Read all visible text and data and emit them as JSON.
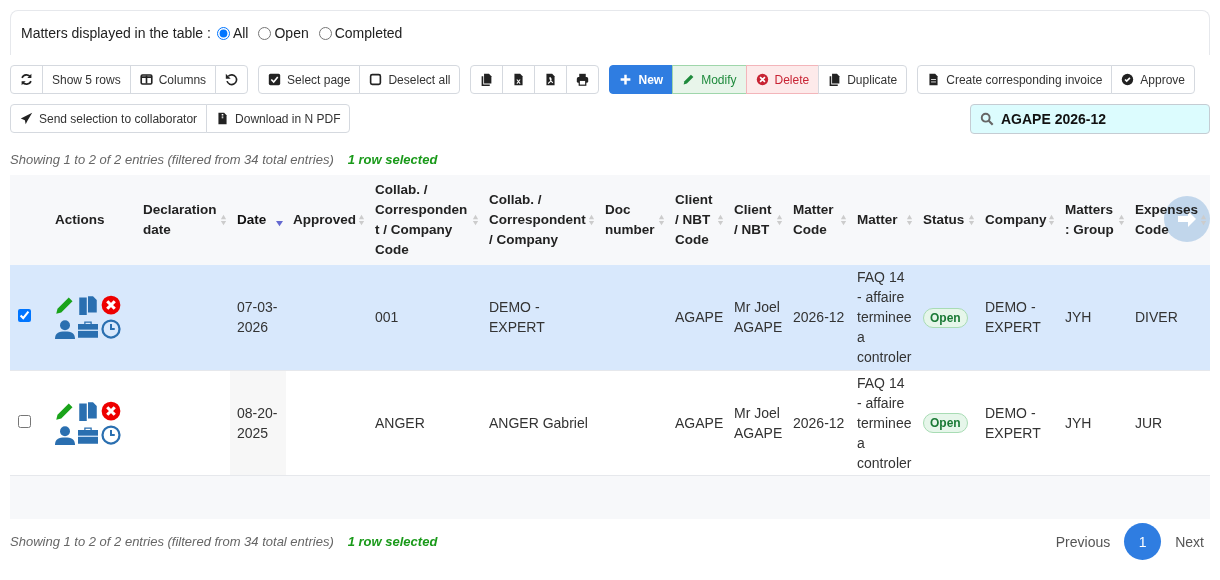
{
  "filter": {
    "label": "Matters displayed in the table :",
    "options": [
      {
        "label": "All",
        "selected": true
      },
      {
        "label": "Open",
        "selected": false
      },
      {
        "label": "Completed",
        "selected": false
      }
    ]
  },
  "toolbar": [
    [
      {
        "kind": "refresh"
      },
      {
        "kind": "text",
        "label": "Show 5 rows"
      },
      {
        "kind": "columns",
        "label": "Columns"
      },
      {
        "kind": "undo"
      }
    ],
    [
      {
        "kind": "check",
        "label": "Select page"
      },
      {
        "kind": "square",
        "label": "Deselect all"
      }
    ],
    [
      {
        "kind": "copy"
      },
      {
        "kind": "excel"
      },
      {
        "kind": "pdf"
      },
      {
        "kind": "print"
      }
    ],
    [
      {
        "kind": "plus",
        "label": "New"
      },
      {
        "kind": "pencil",
        "label": "Modify"
      },
      {
        "kind": "delete",
        "label": "Delete"
      },
      {
        "kind": "duplicate",
        "label": "Duplicate"
      }
    ],
    [
      {
        "kind": "file",
        "label": "Create corresponding invoice"
      },
      {
        "kind": "approve",
        "label": "Approve"
      }
    ],
    [
      {
        "kind": "send",
        "label": "Send selection to collaborator"
      },
      {
        "kind": "zip",
        "label": "Download in N PDF"
      }
    ]
  ],
  "search": {
    "value": "AGAPE 2026-12"
  },
  "info": "Showing 1 to 2 of 2 entries (filtered from 34 total entries)",
  "selection_info": "1 row selected",
  "table": {
    "columns": [
      {
        "label": "Actions",
        "sortable": false,
        "sorted_descending": false
      },
      {
        "label": "Declaration date",
        "sortable": true,
        "sorted_descending": false
      },
      {
        "label": "Date",
        "sortable": true,
        "sorted_descending": true
      },
      {
        "label": "Approved",
        "sortable": true,
        "sorted_descending": false
      },
      {
        "label": "Collab. / Correspondent / Company Code",
        "sortable": true,
        "sorted_descending": false
      },
      {
        "label": "Collab. / Correspondent / Company",
        "sortable": true,
        "sorted_descending": false
      },
      {
        "label": "Doc number",
        "sortable": true,
        "sorted_descending": false
      },
      {
        "label": "Client / NBT Code",
        "sortable": true,
        "sorted_descending": false
      },
      {
        "label": "Client / NBT",
        "sortable": true,
        "sorted_descending": false
      },
      {
        "label": "Matter Code",
        "sortable": true,
        "sorted_descending": false
      },
      {
        "label": "Matter",
        "sortable": true,
        "sorted_descending": false
      },
      {
        "label": "Status",
        "sortable": true,
        "sorted_descending": false
      },
      {
        "label": "Company",
        "sortable": true,
        "sorted_descending": false
      },
      {
        "label": "Matters : Group",
        "sortable": true,
        "sorted_descending": false
      },
      {
        "label": "Expenses Code",
        "sortable": true,
        "sorted_descending": false
      }
    ],
    "rows": [
      {
        "selected": true,
        "cells": [
          {
            "kind": "actions"
          },
          {},
          {
            "text": "07-03-2026"
          },
          {},
          {
            "text": "001"
          },
          {
            "text": "DEMO - EXPERT"
          },
          {},
          {
            "text": "AGAPE"
          },
          {
            "text": "Mr Joel AGAPE"
          },
          {
            "text": "2026-12"
          },
          {
            "text": "FAQ 14 - affaire terminee a controler"
          },
          {
            "kind": "badge",
            "text": "Open"
          },
          {
            "text": "DEMO - EXPERT"
          },
          {
            "text": "JYH"
          },
          {
            "text": "DIVER"
          }
        ]
      },
      {
        "selected": false,
        "cells": [
          {
            "kind": "actions"
          },
          {},
          {
            "text": "08-20-2025"
          },
          {},
          {
            "text": "ANGER"
          },
          {
            "text": "ANGER Gabriel"
          },
          {},
          {
            "text": "AGAPE"
          },
          {
            "text": "Mr Joel AGAPE"
          },
          {
            "text": "2026-12"
          },
          {
            "text": "FAQ 14 - affaire terminee a controler"
          },
          {
            "kind": "badge",
            "text": "Open"
          },
          {
            "text": "DEMO - EXPERT"
          },
          {
            "text": "JYH"
          },
          {
            "text": "JUR"
          }
        ]
      }
    ]
  },
  "footer_info": "Showing 1 to 2 of 2 entries (filtered from 34 total entries)",
  "footer_selection_info": "1 row selected",
  "pagination": {
    "previous": "Previous",
    "pages": [
      {
        "label": "1",
        "selected": true
      }
    ],
    "next": "Next"
  }
}
